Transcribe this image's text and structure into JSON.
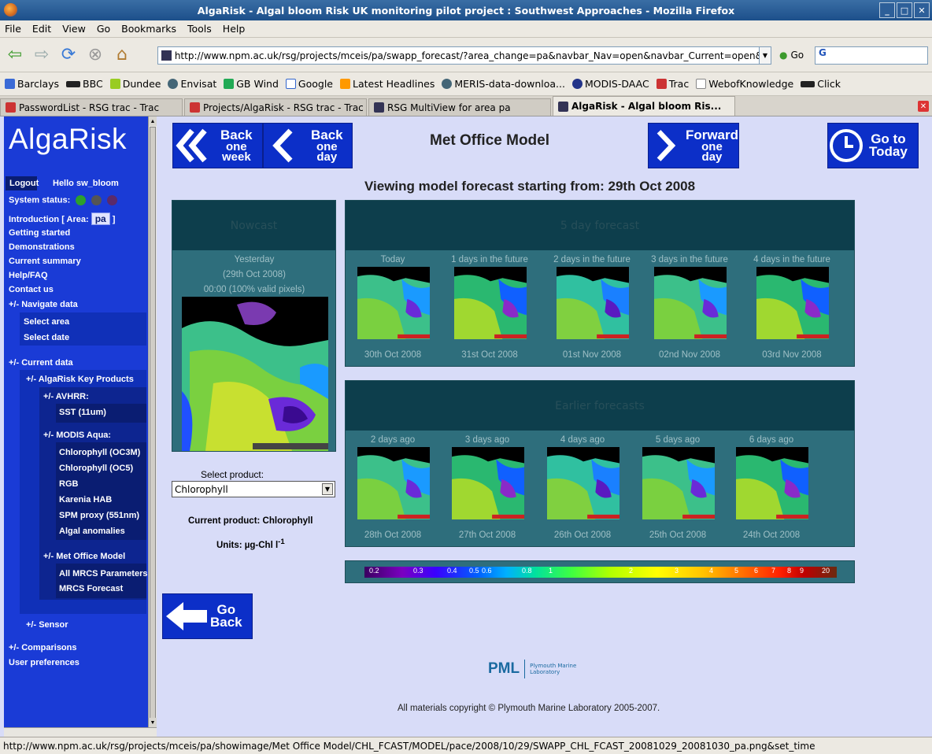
{
  "window": {
    "title": "AlgaRisk - Algal bloom Risk UK monitoring pilot project : Southwest Approaches - Mozilla Firefox"
  },
  "menu": [
    "File",
    "Edit",
    "View",
    "Go",
    "Bookmarks",
    "Tools",
    "Help"
  ],
  "url": "http://www.npm.ac.uk/rsg/projects/mceis/pa/swapp_forecast/?area_change=pa&navbar_Nav=open&navbar_Current=open&",
  "go_label": "Go",
  "search_value": "G",
  "bookmarks": [
    "Barclays",
    "BBC",
    "Dundee",
    "Envisat",
    "GB Wind",
    "Google",
    "Latest Headlines",
    "MERIS-data-downloa...",
    "MODIS-DAAC",
    "Trac",
    "WebofKnowledge",
    "Click"
  ],
  "tabs": [
    "PasswordList - RSG trac - Trac",
    "Projects/AlgaRisk - RSG trac - Trac",
    "RSG MultiView for area pa",
    "AlgaRisk - Algal bloom Ris..."
  ],
  "sidebar": {
    "logo": "AlgaRisk",
    "logout": "Logout",
    "hello": "Hello sw_bloom",
    "system_status": "System status:",
    "introduction": "Introduction",
    "area_label": "[ Area:",
    "area_value": "pa",
    "area_close": "]",
    "getting_started": "Getting started",
    "demonstrations": "Demonstrations",
    "current_summary": "Current summary",
    "help": "Help/FAQ",
    "contact": "Contact us",
    "navigate_data": "+/-  Navigate data",
    "select_area": "Select area",
    "select_date": "Select date",
    "current_data": "+/-  Current data",
    "key_products": "+/-  AlgaRisk Key Products",
    "avhrr": "+/-  AVHRR:",
    "sst": "SST (11um)",
    "modis": "+/-  MODIS Aqua:",
    "chl_oc3m": "Chlorophyll (OC3M)",
    "chl_oc5": "Chlorophyll (OC5)",
    "rgb": "RGB",
    "karenia": "Karenia HAB",
    "spm": "SPM proxy (551nm)",
    "anomalies": "Algal anomalies",
    "met_office": "+/-  Met Office Model",
    "all_mrcs": "All MRCS Parameters",
    "mrcs_forecast": "MRCS Forecast",
    "sensor": "+/-  Sensor",
    "comparisons": "+/-  Comparisons",
    "user_prefs": "User preferences"
  },
  "nav": {
    "back_week": [
      "Back",
      "one",
      "week"
    ],
    "back_day": [
      "Back",
      "one",
      "day"
    ],
    "forward_day": [
      "Forward",
      "one",
      "day"
    ],
    "today": [
      "Go to",
      "Today"
    ],
    "title": "Met Office Model",
    "go_back": [
      "Go",
      "Back"
    ]
  },
  "viewing": "Viewing model forecast starting from: 29th Oct 2008",
  "nowcast": {
    "header": "Nowcast",
    "line1": "Yesterday",
    "line2": "(29th Oct 2008)",
    "line3": "00:00 (100% valid pixels)"
  },
  "forecast": {
    "header": "5 day forecast",
    "items": [
      {
        "top": "Today",
        "bottom": "30th Oct 2008"
      },
      {
        "top": "1 days in the future",
        "bottom": "31st Oct 2008"
      },
      {
        "top": "2 days in the future",
        "bottom": "01st Nov 2008"
      },
      {
        "top": "3 days in the future",
        "bottom": "02nd Nov 2008"
      },
      {
        "top": "4 days in the future",
        "bottom": "03rd Nov 2008"
      }
    ]
  },
  "earlier": {
    "header": "Earlier forecasts",
    "items": [
      {
        "top": "2 days ago",
        "bottom": "28th Oct 2008"
      },
      {
        "top": "3 days ago",
        "bottom": "27th Oct 2008"
      },
      {
        "top": "4 days ago",
        "bottom": "26th Oct 2008"
      },
      {
        "top": "5 days ago",
        "bottom": "25th Oct 2008"
      },
      {
        "top": "6 days ago",
        "bottom": "24th Oct 2008"
      }
    ]
  },
  "product": {
    "select_label": "Select product:",
    "selected": "Chlorophyll",
    "current": "Current product: Chlorophyll",
    "units_prefix": "Units: µg-Chl l",
    "units_sup": "-1"
  },
  "legend_ticks": [
    "0.2",
    "0.3",
    "0.4",
    "0.5",
    "0.6",
    "0.8",
    "1",
    "2",
    "3",
    "4",
    "5",
    "6",
    "7",
    "8",
    "9",
    "20"
  ],
  "footer": {
    "pml": "PML",
    "pml_small1": "Plymouth Marine",
    "pml_small2": "Laboratory",
    "copyright": "All materials copyright © Plymouth Marine Laboratory 2005-2007."
  },
  "status_url": "http://www.npm.ac.uk/rsg/projects/mceis/pa/showimage/Met Office Model/CHL_FCAST/MODEL/pace/2008/10/29/SWAPP_CHL_FCAST_20081029_20081030_pa.png&set_time"
}
